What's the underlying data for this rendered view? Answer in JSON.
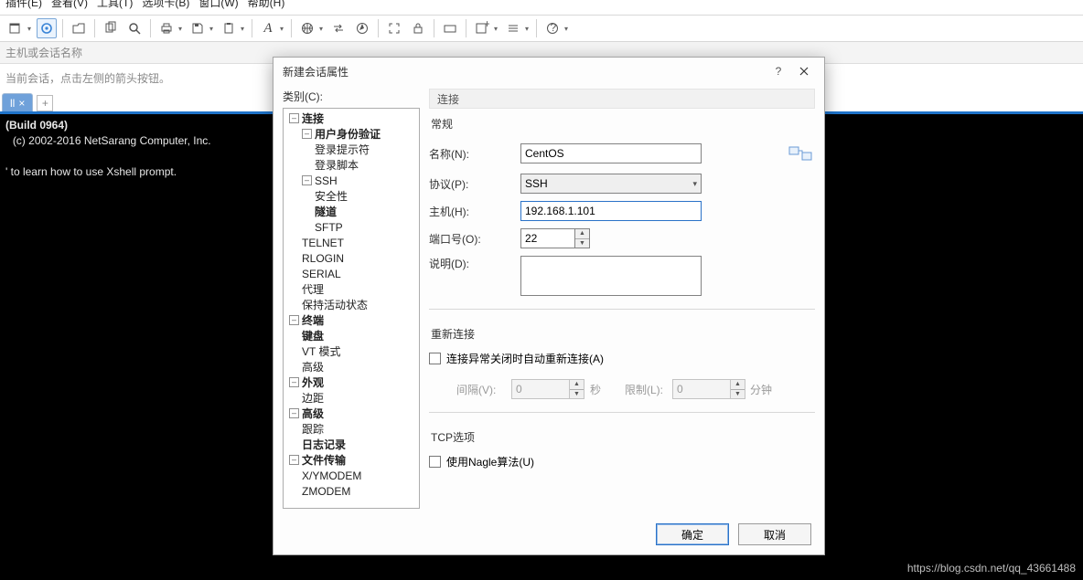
{
  "menubar": [
    "插件(E)",
    "查看(V)",
    "工具(T)",
    "选项卡(B)",
    "窗口(W)",
    "帮助(H)"
  ],
  "addr_placeholder": "主机或会话名称",
  "hint": "当前会话，点击左侧的箭头按钮。",
  "tab_label": "ll ",
  "tab_add": "+",
  "terminal": {
    "line1": "(Build 0964)",
    "line2": "(c) 2002-2016 NetSarang Computer, Inc.",
    "line3": "' to learn how to use Xshell prompt."
  },
  "watermark": "https://blog.csdn.net/qq_43661488",
  "dialog": {
    "title": "新建会话属性",
    "help": "?",
    "cat_label": "类别(C):",
    "tree": {
      "conn": "连接",
      "auth": "用户身份验证",
      "login_prompt": "登录提示符",
      "login_script": "登录脚本",
      "ssh": "SSH",
      "security": "安全性",
      "tunnel": "隧道",
      "sftp": "SFTP",
      "telnet": "TELNET",
      "rlogin": "RLOGIN",
      "serial": "SERIAL",
      "proxy": "代理",
      "keepalive": "保持活动状态",
      "terminal": "终端",
      "keyboard": "键盘",
      "vt": "VT 模式",
      "adv_t": "高级",
      "appearance": "外观",
      "margin": "边距",
      "advanced": "高级",
      "trace": "跟踪",
      "log": "日志记录",
      "filetrans": "文件传输",
      "xymodem": "X/YMODEM",
      "zmodem": "ZMODEM"
    },
    "section": "连接",
    "grp_general": "常规",
    "lbl_name": "名称(N):",
    "val_name": "CentOS",
    "lbl_proto": "协议(P):",
    "val_proto": "SSH",
    "lbl_host": "主机(H):",
    "val_host": "192.168.1.101",
    "lbl_port": "端口号(O):",
    "val_port": "22",
    "lbl_desc": "说明(D):",
    "grp_reconn": "重新连接",
    "cb_reconn": "连接异常关闭时自动重新连接(A)",
    "lbl_interval": "间隔(V):",
    "val_interval": "0",
    "unit_sec": "秒",
    "lbl_limit": "限制(L):",
    "val_limit": "0",
    "unit_min": "分钟",
    "grp_tcp": "TCP选项",
    "cb_nagle": "使用Nagle算法(U)",
    "btn_ok": "确定",
    "btn_cancel": "取消"
  }
}
